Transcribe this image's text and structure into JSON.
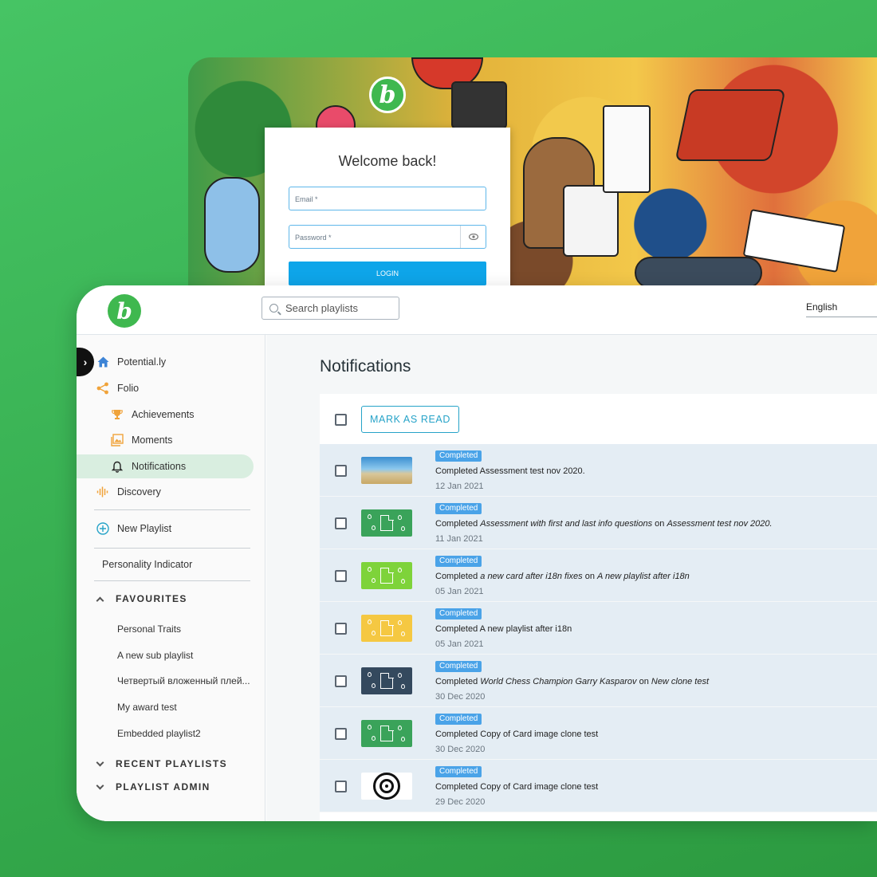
{
  "login": {
    "title": "Welcome back!",
    "email_label": "Email *",
    "password_label": "Password *",
    "login_button": "LOGIN",
    "logo_letter": "b"
  },
  "app": {
    "logo_letter": "b",
    "search_placeholder": "Search playlists",
    "language": "English"
  },
  "sidebar": {
    "items": [
      {
        "label": "Potential.ly",
        "icon": "home-icon"
      },
      {
        "label": "Folio",
        "icon": "share-icon"
      },
      {
        "label": "Achievements",
        "icon": "trophy-icon"
      },
      {
        "label": "Moments",
        "icon": "image-icon"
      },
      {
        "label": "Notifications",
        "icon": "bell-icon",
        "active": true
      },
      {
        "label": "Discovery",
        "icon": "audio-wave-icon"
      }
    ],
    "new_playlist": "New Playlist",
    "personality_indicator": "Personality Indicator",
    "favourites_heading": "FAVOURITES",
    "favourites": [
      "Personal Traits",
      "A new sub playlist",
      "Четвертый вложенный плей...",
      "My award test",
      "Embedded playlist2"
    ],
    "recent_heading": "RECENT PLAYLISTS",
    "admin_heading": "PLAYLIST ADMIN"
  },
  "main": {
    "title": "Notifications",
    "mark_as_read": "MARK AS READ",
    "notifications": [
      {
        "badge": "Completed",
        "prefix": "Completed ",
        "item": "",
        "mid": "Assessment test nov 2020.",
        "target": "",
        "date": "12 Jan 2021",
        "thumb": "beach"
      },
      {
        "badge": "Completed",
        "prefix": "Completed ",
        "item": "Assessment with first and last info questions",
        "mid": " on ",
        "target": "Assessment test nov 2020.",
        "date": "11 Jan 2021",
        "thumb": "doc",
        "color": "#3aa35a"
      },
      {
        "badge": "Completed",
        "prefix": "Completed ",
        "item": "a new card after i18n fixes",
        "mid": " on ",
        "target": "A new playlist after i18n",
        "date": "05 Jan 2021",
        "thumb": "doc",
        "color": "#7ed33a"
      },
      {
        "badge": "Completed",
        "prefix": "Completed ",
        "item": "",
        "mid": "A new playlist after i18n",
        "target": "",
        "date": "05 Jan 2021",
        "thumb": "doc",
        "color": "#f5c842"
      },
      {
        "badge": "Completed",
        "prefix": "Completed ",
        "item": "World Chess Champion Garry Kasparov",
        "mid": " on ",
        "target": "New clone test",
        "date": "30 Dec 2020",
        "thumb": "doc",
        "color": "#34495e"
      },
      {
        "badge": "Completed",
        "prefix": "Completed ",
        "item": "",
        "mid": "Copy of Card image clone test",
        "target": "",
        "date": "30 Dec 2020",
        "thumb": "doc",
        "color": "#3aa35a"
      },
      {
        "badge": "Completed",
        "prefix": "Completed ",
        "item": "",
        "mid": "Copy of Card image clone test",
        "target": "",
        "date": "29 Dec 2020",
        "thumb": "target"
      }
    ]
  },
  "colors": {
    "brand_green": "#3fb84f",
    "accent_blue": "#26a3c8",
    "badge_blue": "#4aa3e8",
    "row_bg": "#e4edf4",
    "active_nav_bg": "#d9eee0"
  }
}
